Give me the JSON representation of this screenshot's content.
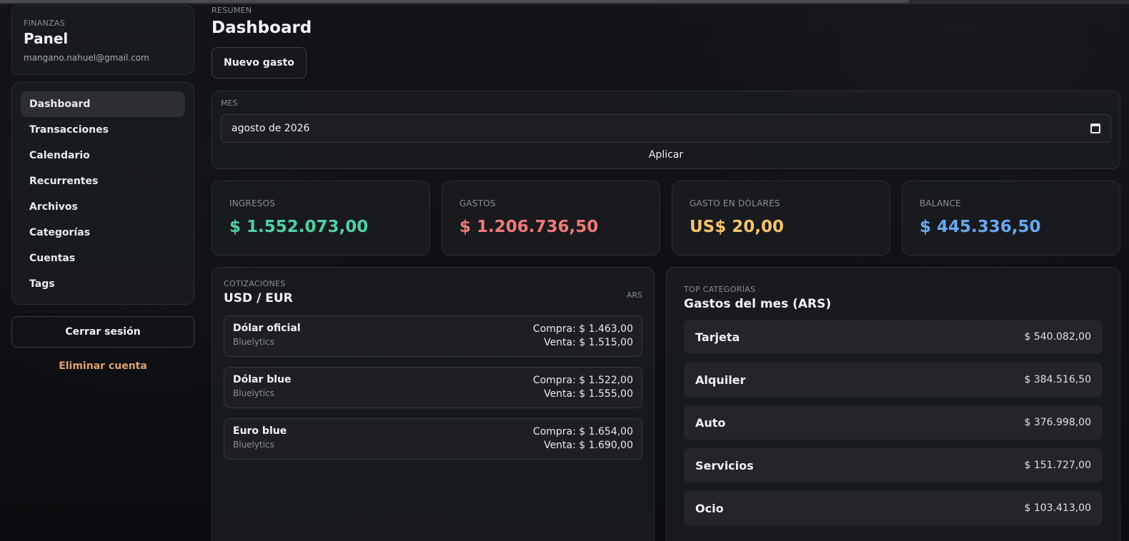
{
  "sidebar": {
    "eyebrow": "FINANZAS",
    "title": "Panel",
    "email": "mangano.nahuel@gmail.com",
    "items": [
      {
        "label": "Dashboard",
        "active": true
      },
      {
        "label": "Transacciones"
      },
      {
        "label": "Calendario"
      },
      {
        "label": "Recurrentes"
      },
      {
        "label": "Archivos"
      },
      {
        "label": "Categorías"
      },
      {
        "label": "Cuentas"
      },
      {
        "label": "Tags"
      }
    ],
    "logout_label": "Cerrar sesión",
    "delete_label": "Eliminar cuenta"
  },
  "header": {
    "eyebrow": "RESUMEN",
    "title": "Dashboard",
    "new_button": "Nuevo gasto"
  },
  "month_filter": {
    "label": "MES",
    "value": "agosto de 2026",
    "apply_label": "Aplicar"
  },
  "stats": [
    {
      "label": "INGRESOS",
      "value": "$ 1.552.073,00",
      "color": "#4fd1a5"
    },
    {
      "label": "GASTOS",
      "value": "$ 1.206.736,50",
      "color": "#f07a7a"
    },
    {
      "label": "GASTO EN DÓLARES",
      "value": "US$ 20,00",
      "color": "#f5c36b"
    },
    {
      "label": "BALANCE",
      "value": "$ 445.336,50",
      "color": "#6aa8f0"
    }
  ],
  "quotes": {
    "eyebrow": "COTIZACIONES",
    "title": "USD / EUR",
    "currency_tag": "ARS",
    "items": [
      {
        "name": "Dólar oficial",
        "source": "Bluelytics",
        "buy": "Compra: $ 1.463,00",
        "sell": "Venta: $ 1.515,00"
      },
      {
        "name": "Dólar blue",
        "source": "Bluelytics",
        "buy": "Compra: $ 1.522,00",
        "sell": "Venta: $ 1.555,00"
      },
      {
        "name": "Euro blue",
        "source": "Bluelytics",
        "buy": "Compra: $ 1.654,00",
        "sell": "Venta: $ 1.690,00"
      }
    ]
  },
  "top_categories": {
    "eyebrow": "TOP CATEGORÍAS",
    "title": "Gastos del mes (ARS)",
    "items": [
      {
        "name": "Tarjeta",
        "amount": "$ 540.082,00"
      },
      {
        "name": "Alquiler",
        "amount": "$ 384.516,50"
      },
      {
        "name": "Auto",
        "amount": "$ 376.998,00"
      },
      {
        "name": "Servicios",
        "amount": "$ 151.727,00"
      },
      {
        "name": "Ocio",
        "amount": "$ 103.413,00"
      }
    ]
  }
}
